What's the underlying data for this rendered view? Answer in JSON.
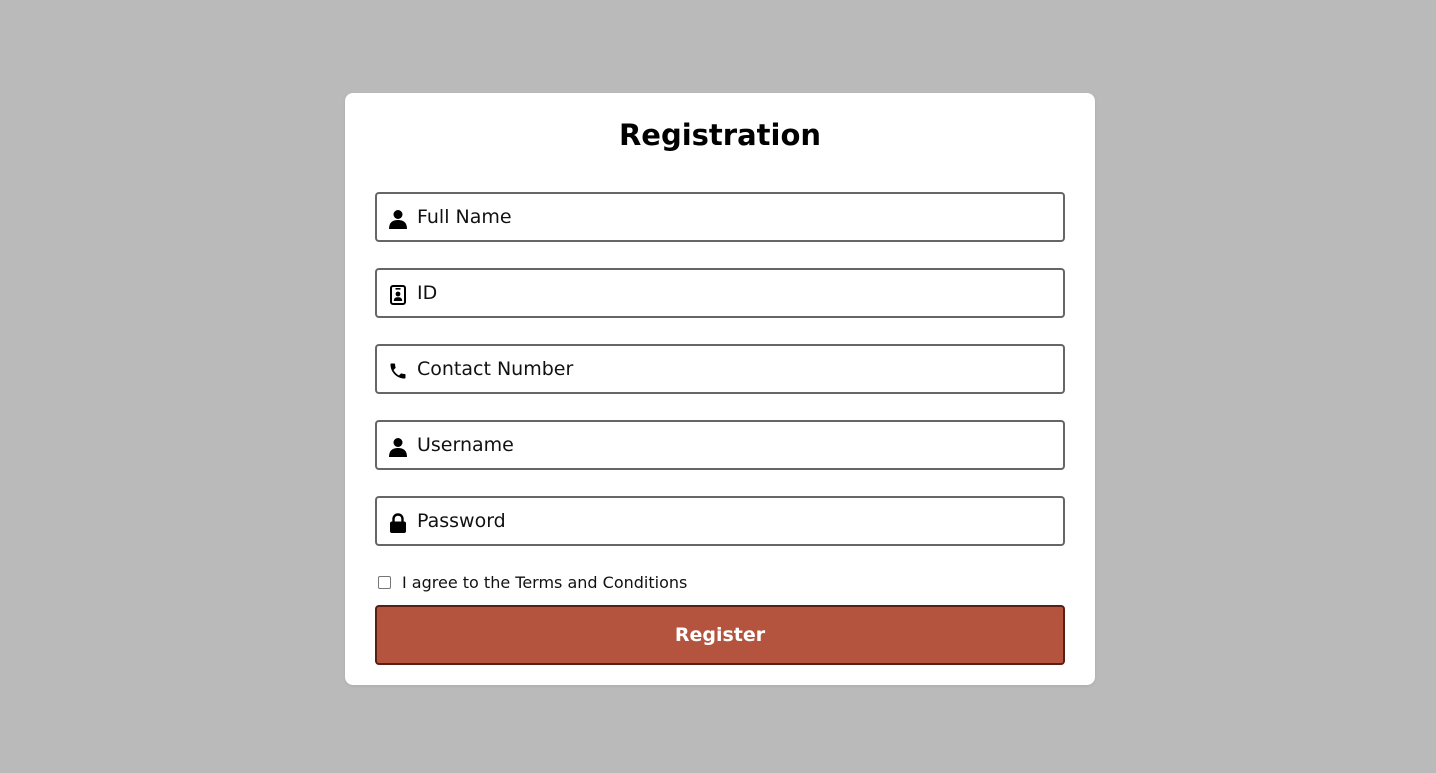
{
  "form": {
    "title": "Registration",
    "fields": [
      {
        "placeholder": "Full Name",
        "value": "",
        "icon": "user-icon"
      },
      {
        "placeholder": "ID",
        "value": "",
        "icon": "id-card-icon"
      },
      {
        "placeholder": "Contact Number",
        "value": "",
        "icon": "phone-icon"
      },
      {
        "placeholder": "Username",
        "value": "",
        "icon": "user-icon"
      },
      {
        "placeholder": "Password",
        "value": "",
        "icon": "lock-icon"
      }
    ],
    "terms_label": "I agree to the Terms and Conditions",
    "terms_checked": false,
    "register_label": "Register"
  },
  "colors": {
    "background": "#bababa",
    "card": "#ffffff",
    "field_border": "#666666",
    "button": "#b4543e",
    "button_border": "#5a1f14",
    "button_text": "#ffffff"
  }
}
